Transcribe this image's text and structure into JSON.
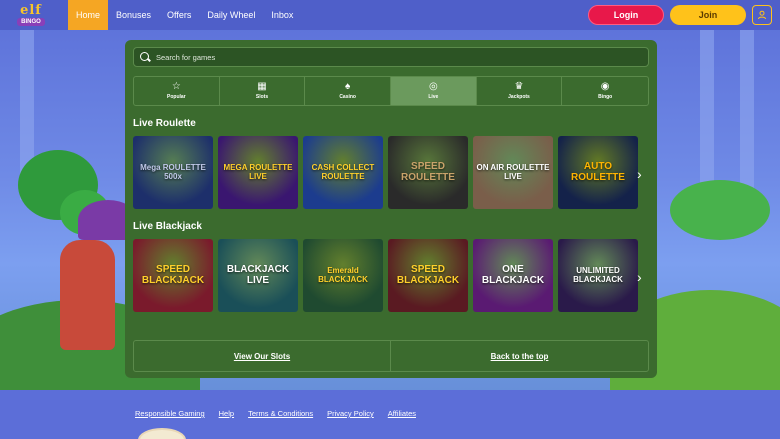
{
  "logo": {
    "top": "elf",
    "bottom": "BINGO"
  },
  "nav": {
    "items": [
      {
        "label": "Home",
        "active": true
      },
      {
        "label": "Bonuses",
        "active": false
      },
      {
        "label": "Offers",
        "active": false
      },
      {
        "label": "Daily Wheel",
        "active": false
      },
      {
        "label": "Inbox",
        "active": false
      }
    ]
  },
  "auth": {
    "login_label": "Login",
    "join_label": "Join"
  },
  "search": {
    "placeholder": "Search for games"
  },
  "categories": [
    {
      "label": "Popular",
      "icon": "star-icon",
      "active": false
    },
    {
      "label": "Slots",
      "icon": "slots-icon",
      "active": false
    },
    {
      "label": "Casino",
      "icon": "cards-icon",
      "active": false
    },
    {
      "label": "Live",
      "icon": "roulette-icon",
      "active": true
    },
    {
      "label": "Jackpots",
      "icon": "crown-icon",
      "active": false
    },
    {
      "label": "Bingo",
      "icon": "bingo-ball-icon",
      "active": false
    }
  ],
  "sections": [
    {
      "title": "Live Roulette",
      "tiles": [
        {
          "text": "Mega ROULETTE 500x",
          "bg": "#1d2f6b",
          "accent": "#c0c8e8"
        },
        {
          "text": "MEGA ROULETTE LIVE",
          "bg": "#3a1670",
          "accent": "#ffd02b"
        },
        {
          "text": "CASH COLLECT ROULETTE",
          "bg": "#1c3c8e",
          "accent": "#ffd02b"
        },
        {
          "text": "SPEED ROULETTE",
          "bg": "#2a2a2a",
          "accent": "#c9a36a"
        },
        {
          "text": "ON AIR ROULETTE LIVE",
          "bg": "#7a5e4a",
          "accent": "#ffffff"
        },
        {
          "text": "AUTO ROULETTE",
          "bg": "#14224a",
          "accent": "#ffb400"
        }
      ]
    },
    {
      "title": "Live Blackjack",
      "tiles": [
        {
          "text": "SPEED BLACKJACK",
          "bg": "#7a1a2c",
          "accent": "#ffd02b"
        },
        {
          "text": "BLACKJACK LIVE",
          "bg": "#1a4f58",
          "accent": "#ffffff"
        },
        {
          "text": "Emerald BLACKJACK",
          "bg": "#1f4a30",
          "accent": "#ffd02b"
        },
        {
          "text": "SPEED BLACKJACK",
          "bg": "#5a1a22",
          "accent": "#ffd02b"
        },
        {
          "text": "ONE BLACKJACK",
          "bg": "#5a1a72",
          "accent": "#ffffff"
        },
        {
          "text": "UNLIMITED BLACKJACK",
          "bg": "#2a1a4a",
          "accent": "#ffffff"
        }
      ]
    }
  ],
  "bottom_links": {
    "slots": "View Our Slots",
    "top": "Back to the top"
  },
  "footer": {
    "links": [
      "Responsible Gaming",
      "Help",
      "Terms & Conditions",
      "Privacy Policy",
      "Affiliates"
    ]
  }
}
